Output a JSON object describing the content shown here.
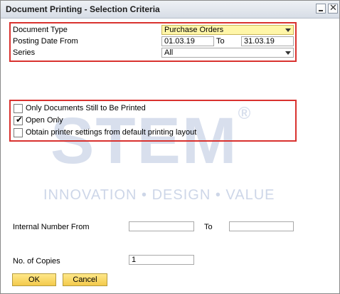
{
  "window": {
    "title": "Document Printing - Selection Criteria"
  },
  "criteria": {
    "document_type_label": "Document Type",
    "document_type_value": "Purchase Orders",
    "posting_date_label": "Posting Date From",
    "date_from": "01.03.19",
    "to_label": "To",
    "date_to": "31.03.19",
    "series_label": "Series",
    "series_value": "All"
  },
  "options": [
    {
      "label": "Only Documents Still to Be Printed",
      "checked": false
    },
    {
      "label": "Open Only",
      "checked": true
    },
    {
      "label": "Obtain printer settings from default printing layout",
      "checked": false
    }
  ],
  "internal_number": {
    "label": "Internal Number From",
    "from_value": "",
    "to_label": "To",
    "to_value": ""
  },
  "copies": {
    "label": "No. of Copies",
    "value": "1"
  },
  "buttons": {
    "ok": "OK",
    "cancel": "Cancel"
  },
  "watermark": {
    "brand": "STEM",
    "registered": "®",
    "tagline": "INNOVATION • DESIGN • VALUE"
  },
  "colors": {
    "highlight_border": "#d9322f",
    "field_highlight": "#fff6a8",
    "button": "#f3c94b"
  }
}
